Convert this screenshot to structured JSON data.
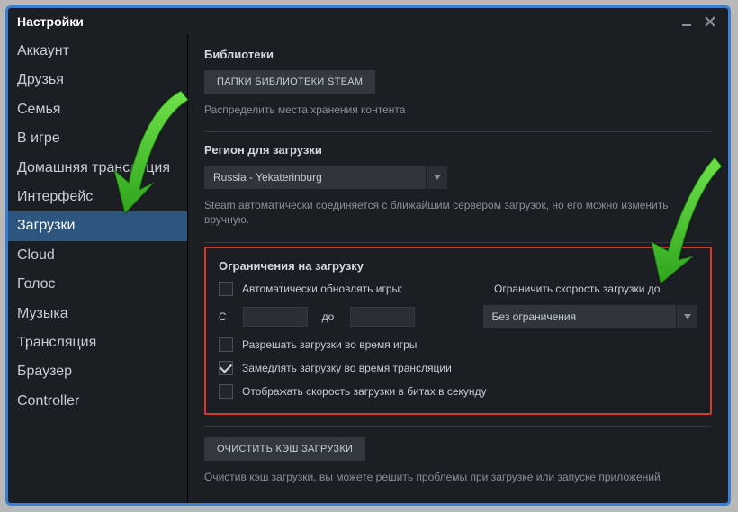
{
  "window": {
    "title": "Настройки"
  },
  "sidebar": {
    "items": [
      {
        "label": "Аккаунт",
        "selected": false
      },
      {
        "label": "Друзья",
        "selected": false
      },
      {
        "label": "Семья",
        "selected": false
      },
      {
        "label": "В игре",
        "selected": false
      },
      {
        "label": "Домашняя трансляция",
        "selected": false
      },
      {
        "label": "Интерфейс",
        "selected": false
      },
      {
        "label": "Загрузки",
        "selected": true
      },
      {
        "label": "Cloud",
        "selected": false
      },
      {
        "label": "Голос",
        "selected": false
      },
      {
        "label": "Музыка",
        "selected": false
      },
      {
        "label": "Трансляция",
        "selected": false
      },
      {
        "label": "Браузер",
        "selected": false
      },
      {
        "label": "Controller",
        "selected": false
      }
    ]
  },
  "main": {
    "libraries": {
      "heading": "Библиотеки",
      "button": "ПАПКИ БИБЛИОТЕКИ STEAM",
      "desc": "Распределить места хранения контента"
    },
    "region": {
      "heading": "Регион для загрузки",
      "selected": "Russia - Yekaterinburg",
      "desc": "Steam автоматически соединяется с ближайшим сервером загрузок, но его можно изменить вручную."
    },
    "restrictions": {
      "heading": "Ограничения на загрузку",
      "auto_update_label": "Автоматически обновлять игры:",
      "limit_speed_label": "Ограничить скорость загрузки до",
      "time_from_label": "С",
      "time_to_label": "до",
      "speed_selected": "Без ограничения",
      "allow_during_game_label": "Разрешать загрузки во время игры",
      "throttle_streaming_label": "Замедлять загрузку во время трансляции",
      "show_bits_label": "Отображать скорость загрузки в битах в секунду"
    },
    "clear_cache": {
      "button": "ОЧИСТИТЬ КЭШ ЗАГРУЗКИ",
      "desc": "Очистив кэш загрузки, вы можете решить проблемы при загрузке или запуске приложений"
    }
  }
}
